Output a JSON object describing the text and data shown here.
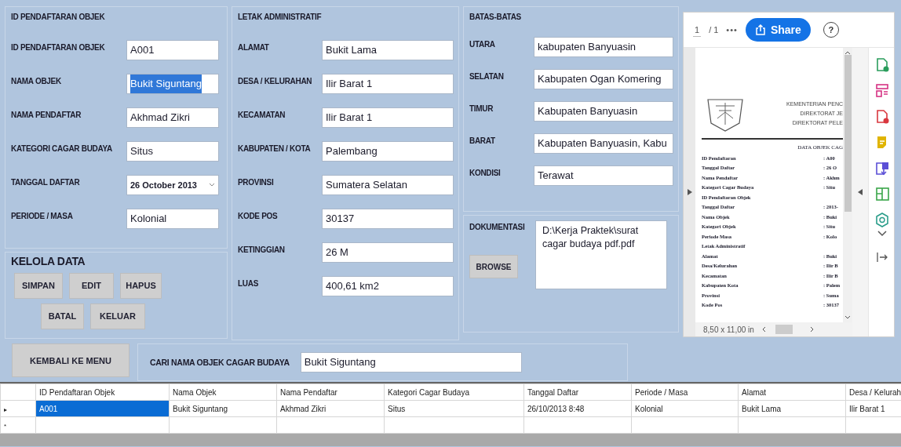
{
  "identity_group": {
    "title": "ID PENDAFTARAN OBJEK",
    "fields": [
      {
        "label": "ID PENDAFTARAN OBJEK",
        "value": "A001",
        "kind": "text",
        "highlighted": false
      },
      {
        "label": "NAMA OBJEK",
        "value": "Bukit Siguntang",
        "kind": "text",
        "highlighted": true
      },
      {
        "label": "NAMA PENDAFTAR",
        "value": "Akhmad Zikri",
        "kind": "text",
        "highlighted": false
      },
      {
        "label": "KATEGORI CAGAR BUDAYA",
        "value": "Situs",
        "kind": "text",
        "highlighted": false
      },
      {
        "label": "TANGGAL DAFTAR",
        "value": "26  October  2013",
        "kind": "date",
        "highlighted": false
      },
      {
        "label": "PERIODE / MASA",
        "value": "Kolonial",
        "kind": "text",
        "highlighted": false
      }
    ]
  },
  "manage_group": {
    "title": "KELOLA DATA",
    "button_rows": [
      [
        "SIMPAN",
        "EDIT",
        "HAPUS"
      ],
      [
        "BATAL",
        "KELUAR"
      ]
    ]
  },
  "location_group": {
    "title": "LETAK ADMINISTRATIF",
    "fields": [
      {
        "label": "ALAMAT",
        "value": "Bukit Lama"
      },
      {
        "label": "DESA / KELURAHAN",
        "value": "Ilir Barat 1"
      },
      {
        "label": "KECAMATAN",
        "value": "Ilir Barat 1"
      },
      {
        "label": "KABUPATEN / KOTA",
        "value": "Palembang"
      },
      {
        "label": "PROVINSI",
        "value": "Sumatera Selatan"
      },
      {
        "label": "KODE POS",
        "value": "30137"
      },
      {
        "label": "KETINGGIAN",
        "value": "26 M"
      },
      {
        "label": "LUAS",
        "value": "400,61 km2"
      }
    ]
  },
  "borders_group": {
    "title": "BATAS-BATAS",
    "fields": [
      {
        "label": "UTARA",
        "value": "kabupaten Banyuasin"
      },
      {
        "label": "SELATAN",
        "value": "Kabupaten Ogan Komering"
      },
      {
        "label": "TIMUR",
        "value": "Kabupaten Banyuasin"
      },
      {
        "label": "BARAT",
        "value": "Kabupaten Banyuasin, Kabu"
      },
      {
        "label": "KONDISI",
        "value": "Terawat"
      }
    ]
  },
  "documentation": {
    "label": "DOKUMENTASI",
    "button": "BROWSE",
    "path": "D:\\Kerja Praktek\\surat cagar budaya pdf.pdf"
  },
  "pdf_viewer": {
    "page": "1",
    "page_count": "/ 1",
    "more": "•••",
    "share": "Share",
    "help": "?",
    "document": {
      "header_lines": [
        "KEMENTERIAN PENC",
        "DIREKTORAT JE",
        "DIREKTORAT PELE"
      ],
      "title": "DATA OBJEK CAG",
      "rows": [
        {
          "label": "ID Pendaftaran",
          "value": ": A00"
        },
        {
          "label": "Tanggal Daftar",
          "value": ": 26 O"
        },
        {
          "label": "Nama Pendaftar",
          "value": ": Akhm"
        },
        {
          "label": "Kategori Cagar Budaya",
          "value": ": Situ"
        },
        {
          "label": "ID Pendaftaran Objek"
        },
        {
          "label": "Tanggal Daftar",
          "value": ": 2013-"
        },
        {
          "label": "Nama Objek",
          "value": ": Buki"
        },
        {
          "label": "Kategori Objek",
          "value": ": Situ"
        },
        {
          "label": "Periode Masa",
          "value": ": Kolo"
        },
        {
          "label": "Letak Administratif"
        },
        {
          "label": "Alamat",
          "value": ": Buki"
        },
        {
          "label": "Desa/Kelurahan",
          "value": ": Ilir B"
        },
        {
          "label": "Kecamatan",
          "value": ": Ilir B"
        },
        {
          "label": "Kabupaten Kota",
          "value": ": Palem"
        },
        {
          "label": "Provinsi",
          "value": ": Suma"
        },
        {
          "label": "Kode Pos",
          "value": ": 30137"
        }
      ]
    },
    "page_size": "8,50 x 11,00 in"
  },
  "menu_button": "KEMBALI KE MENU",
  "search": {
    "label": "CARI NAMA OBJEK CAGAR BUDAYA",
    "value": "Bukit Siguntang"
  },
  "table": {
    "columns": [
      "ID Pendaftaran Objek",
      "Nama Objek",
      "Nama Pendaftar",
      "Kategori Cagar Budaya",
      "Tanggal Daftar",
      "Periode / Masa",
      "Alamat",
      "Desa / Kelurah"
    ],
    "rows": [
      {
        "marker": "▸",
        "selected": true,
        "cells": [
          "A001",
          "Bukit Siguntang",
          "Akhmad Zikri",
          "Situs",
          "26/10/2013 8:48",
          "Kolonial",
          "Bukit Lama",
          "Ilir Barat 1"
        ]
      },
      {
        "marker": "*",
        "selected": false
      }
    ]
  }
}
